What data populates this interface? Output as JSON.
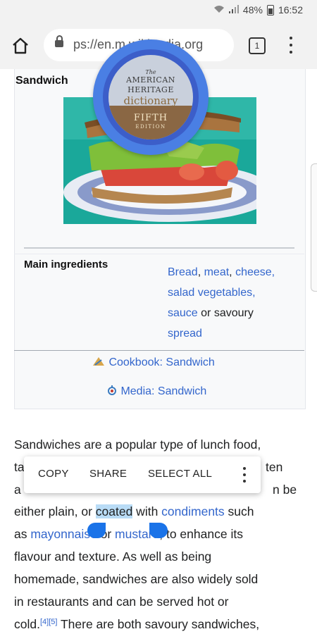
{
  "status": {
    "battery": "48%",
    "time": "16:52"
  },
  "browser": {
    "url": "ps://en.m.wikipedia.org",
    "tab_count": "1"
  },
  "infobox": {
    "title": "Sandwich",
    "ingredients_label": "Main ingredients",
    "ingredients": {
      "line1_a": "Bread",
      "line1_b": ", ",
      "line1_c": "meat",
      "line1_d": ", ",
      "line1_e": "cheese",
      "line1_f": ",",
      "line2": "salad vegetables",
      "line2_tail": ",",
      "line3_link": "sauce",
      "line3_rest": " or savoury",
      "line4": "spread"
    },
    "cookbook": "Cookbook: Sandwich",
    "media": "Media: Sandwich"
  },
  "dictionary": {
    "the": "The",
    "american": "AMERICAN",
    "heritage": "HERITAGE",
    "dictionary": "dictionary",
    "edition": "FIFTH",
    "edition2": "EDITION"
  },
  "context_menu": {
    "copy": "COPY",
    "share": "SHARE",
    "select_all": "SELECT ALL"
  },
  "article": {
    "line1": "Sandwiches are a popular type of lunch food,",
    "line2_start": "ta",
    "line2_end": "ten",
    "line3_start": "a",
    "line3_end": "n be",
    "line4_a": "either plain, or ",
    "line4_sel": "coated",
    "line4_b": " with ",
    "line4_link": "condiments",
    "line4_c": " such",
    "line5_a": "as ",
    "line5_link1": "mayonnaise",
    "line5_b": " or ",
    "line5_link2": "mustard",
    "line5_c": ", to enhance its",
    "line6": "flavour and texture. As well as being",
    "line7": "homemade, sandwiches are also widely sold",
    "line8": "in restaurants and can be served hot or",
    "line9_a": "cold.",
    "ref1": "[4]",
    "ref2": "[5]",
    "line9_b": " There are both savoury sandwiches,"
  }
}
